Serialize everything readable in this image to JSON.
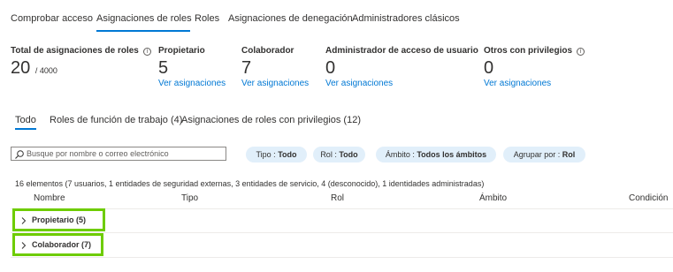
{
  "top_tabs": [
    {
      "label": "Comprobar acceso"
    },
    {
      "label": "Asignaciones de roles"
    },
    {
      "label": "Roles"
    },
    {
      "label": "Asignaciones de denegación"
    },
    {
      "label": "Administradores clásicos"
    }
  ],
  "active_top_tab": "Asignaciones de roles",
  "stats": {
    "total": {
      "label": "Total de asignaciones de roles",
      "value": "20",
      "max": "/ 4000"
    },
    "owner": {
      "label": "Propietario",
      "value": "5",
      "link": "Ver asignaciones"
    },
    "contributor": {
      "label": "Colaborador",
      "value": "7",
      "link": "Ver asignaciones"
    },
    "uaa": {
      "label": "Administrador de acceso de usuario",
      "value": "0",
      "link": "Ver asignaciones"
    },
    "privileged": {
      "label": "Otros con privilegios",
      "value": "0",
      "link": "Ver asignaciones"
    }
  },
  "sub_tabs": [
    {
      "label": "Todo"
    },
    {
      "label": "Roles de función de trabajo (4)"
    },
    {
      "label": "Asignaciones de roles con privilegios (12)"
    }
  ],
  "active_sub_tab": "Todo",
  "search": {
    "placeholder": "Busque por nombre o correo electrónico"
  },
  "filters": [
    {
      "key": "Tipo :",
      "value": "Todo"
    },
    {
      "key": "Rol :",
      "value": "Todo"
    },
    {
      "key": "Ámbito :",
      "value": "Todos los ámbitos"
    },
    {
      "key": "Agrupar por :",
      "value": "Rol"
    }
  ],
  "summary": "16 elementos (7 usuarios, 1 entidades de seguridad externas, 3 entidades de servicio, 4 (desconocido), 1 identidades administradas)",
  "columns": [
    "Nombre",
    "Tipo",
    "Rol",
    "Ámbito",
    "Condición"
  ],
  "groups": [
    {
      "label": "Propietario (5)"
    },
    {
      "label": "Colaborador (7)"
    }
  ],
  "colors": {
    "accent": "#0078d4",
    "highlight": "#6ecc00",
    "pill_bg": "#e1effa"
  },
  "icons": [
    "info-icon",
    "search-icon",
    "chevron-right-icon"
  ]
}
